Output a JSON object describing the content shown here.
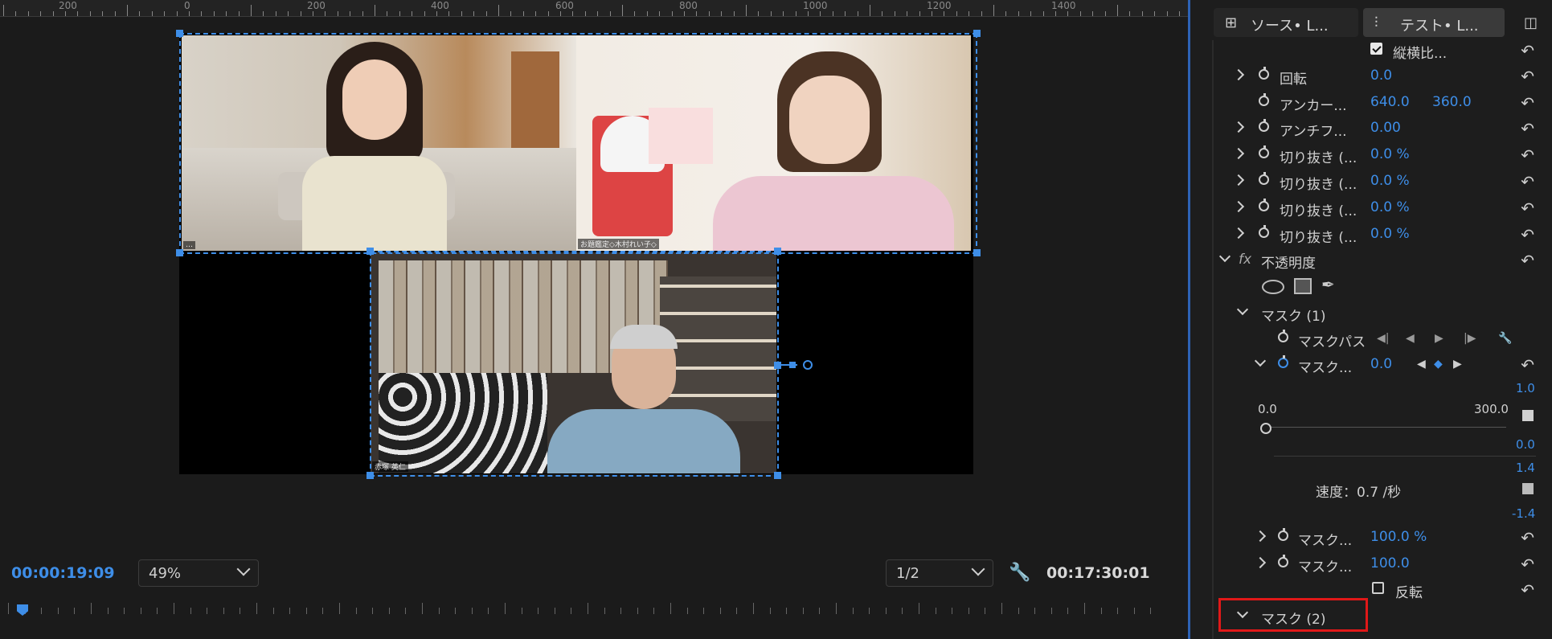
{
  "monitor": {
    "ruler_labels": [
      "200",
      "0",
      "200",
      "400",
      "600",
      "800",
      "1000",
      "1200",
      "1400"
    ],
    "timecode_current": "00:00:19:09",
    "zoom": "49%",
    "resolution": "1/2",
    "timecode_duration": "00:17:30:01",
    "videos": {
      "top_left_tag": "…",
      "top_right_tag": "お題鑑定◇木村れい子◇",
      "bottom_tag": "赤塚 英仁"
    }
  },
  "panel": {
    "tabs": [
      {
        "label": "ソース• L...",
        "icon": "source-icon"
      },
      {
        "label": "テスト• L...",
        "icon": "effect-controls-icon",
        "active": true
      }
    ],
    "rows": {
      "aspect": "縦横比...",
      "rotation": {
        "label": "回転",
        "value": "0.0"
      },
      "anchor": {
        "label": "アンカー...",
        "x": "640.0",
        "y": "360.0"
      },
      "antiflicker": {
        "label": "アンチフ...",
        "value": "0.00"
      },
      "crop1": {
        "label": "切り抜き (...",
        "value": "0.0 %"
      },
      "crop2": {
        "label": "切り抜き (...",
        "value": "0.0 %"
      },
      "crop3": {
        "label": "切り抜き (...",
        "value": "0.0 %"
      },
      "crop4": {
        "label": "切り抜き (...",
        "value": "0.0 %"
      },
      "opacity_fx": "fx",
      "opacity": "不透明度",
      "mask1": "マスク (1)",
      "mask_path": "マスクパス",
      "mask_feather": {
        "label": "マスク...",
        "value": "0.0"
      },
      "graph_top": "1.0",
      "graph_min": "0.0",
      "graph_max": "300.0",
      "graph_zero": "0.0",
      "graph_hi": "1.4",
      "speed": "速度：0.7 /秒",
      "graph_lo": "-1.4",
      "mask_opacity": {
        "label": "マスク...",
        "value": "100.0 %"
      },
      "mask_expansion": {
        "label": "マスク...",
        "value": "100.0"
      },
      "invert": "反転",
      "mask2": "マスク (2)"
    }
  },
  "colors": {
    "accent": "#3e8ee8",
    "highlight": "#e01818",
    "bg": "#1b1b1b"
  }
}
